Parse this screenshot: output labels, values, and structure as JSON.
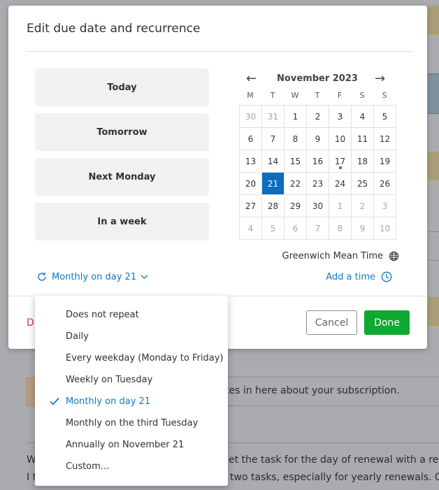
{
  "background": {
    "line1": "tes in here about your subscription.",
    "line2_left": "W",
    "line2_right": "et the task for the day of renewal with a remin",
    "line3_left": "I t",
    "line3_right": "two tasks, especially for yearly renewals. One"
  },
  "dialog": {
    "title": "Edit due date and recurrence",
    "quick_options": [
      "Today",
      "Tomorrow",
      "Next Monday",
      "In a week"
    ],
    "calendar": {
      "month_label": "November 2023",
      "prev_icon": "arrow-left-icon",
      "next_icon": "arrow-right-icon",
      "weekdays": [
        "M",
        "T",
        "W",
        "T",
        "F",
        "S",
        "S"
      ],
      "weeks": [
        [
          "30",
          "31",
          "1",
          "2",
          "3",
          "4",
          "5"
        ],
        [
          "6",
          "7",
          "8",
          "9",
          "10",
          "11",
          "12"
        ],
        [
          "13",
          "14",
          "15",
          "16",
          "17",
          "18",
          "19"
        ],
        [
          "20",
          "21",
          "22",
          "23",
          "24",
          "25",
          "26"
        ],
        [
          "27",
          "28",
          "29",
          "30",
          "1",
          "2",
          "3"
        ],
        [
          "4",
          "5",
          "6",
          "7",
          "8",
          "9",
          "10"
        ]
      ],
      "selected_day": "21",
      "today_marker_day": "17"
    },
    "timezone": "Greenwich Mean Time",
    "add_time": "Add a time",
    "recurrence": "Monthly on day 21",
    "delete_partial": "D",
    "cancel": "Cancel",
    "done": "Done",
    "colors": {
      "accent": "#0f6cbd",
      "link": "#0f7bc2",
      "done": "#0fa831",
      "danger": "#d13438"
    }
  },
  "recurrence_menu": {
    "items": [
      "Does not repeat",
      "Daily",
      "Every weekday (Monday to Friday)",
      "Weekly on Tuesday",
      "Monthly on day 21",
      "Monthly on the third Tuesday",
      "Annually on November 21",
      "Custom..."
    ],
    "selected_index": 4
  }
}
